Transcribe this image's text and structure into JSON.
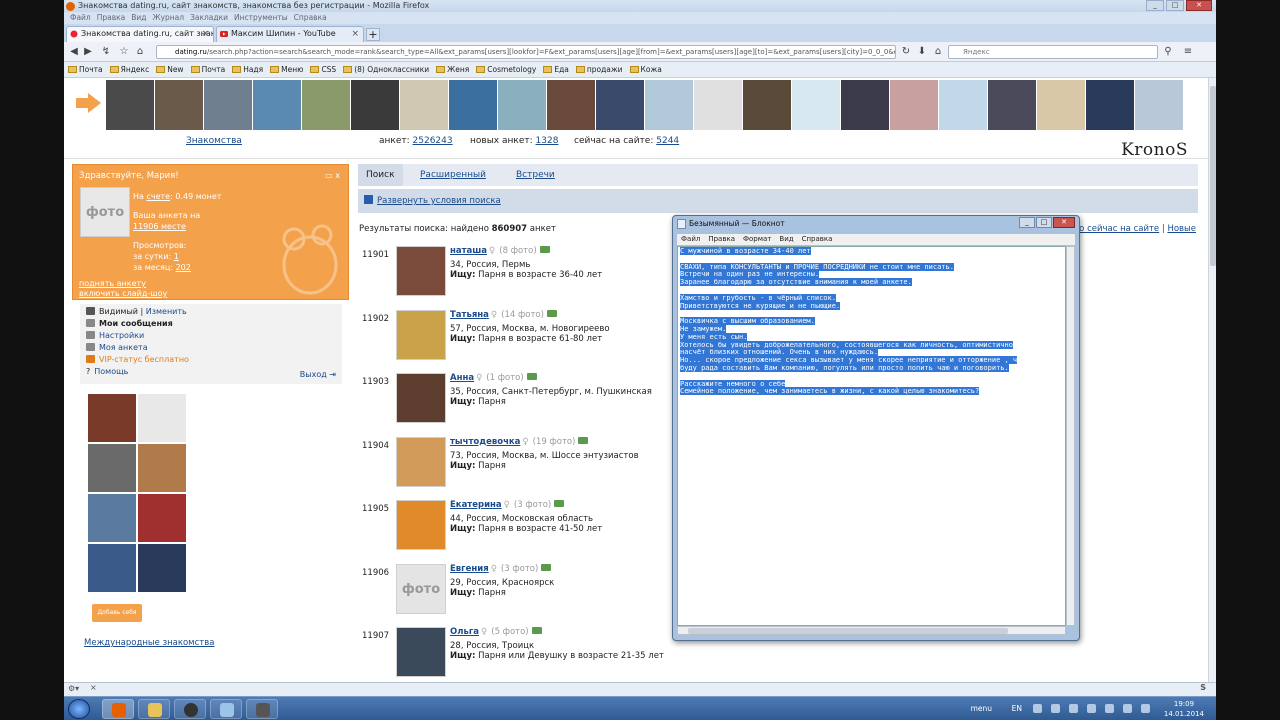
{
  "window": {
    "title": "Знакомства dating.ru, сайт знакомств, знакомства без регистрации - Mozilla Firefox",
    "menu": [
      "Файл",
      "Правка",
      "Вид",
      "Журнал",
      "Закладки",
      "Инструменты",
      "Справка"
    ]
  },
  "tabs": [
    {
      "label": "Знакомства dating.ru, сайт знакомств...",
      "active": true
    },
    {
      "label": "Максим Шипин - YouTube",
      "active": false
    }
  ],
  "url": {
    "host": "dating.ru",
    "path": "/search.php?action=search&search_mode=rank&search_type=All&ext_params[users][lookfor]=F&ext_params[users][age][from]=&ext_params[users][age][to]=&ext_params[users][city]=0_0_0&offset=119",
    "search_placeholder": "Яндекс"
  },
  "bookmarks": [
    "Почта",
    "Яндекс",
    "New",
    "Почта",
    "Надя",
    "Меню",
    "CSS",
    "(8) Одноклассники",
    "Женя",
    "Cosmetology",
    "Еда",
    "продажи",
    "Кожа"
  ],
  "stats": {
    "nav_link": "Знакомства",
    "ankets_label": "анкет:",
    "ankets_value": "2526243",
    "new_label": "новых анкет:",
    "new_value": "1328",
    "online_label": "сейчас на сайте:",
    "online_value": "5244",
    "logo": "KronoS"
  },
  "welcome": {
    "greeting": "Здравствуйте, Мария!",
    "photo_placeholder": "фото",
    "balance_prefix": "На ",
    "balance_link": "счете",
    "balance_suffix": ": 0.49 монет",
    "rank_line1": "Ваша анкета на",
    "rank_link": "11906 месте",
    "views_label": "Просмотров:",
    "views_day_label": "за сутки:",
    "views_day_value": "1",
    "views_month_label": "за месяц:",
    "views_month_value": "202",
    "raise_link": "поднять анкету",
    "slideshow_link": "включить слайд-шоу"
  },
  "user_menu": {
    "visible": "Видимый",
    "change": "Изменить",
    "messages": "Мои сообщения",
    "settings": "Настройки",
    "my_profile": "Моя анкета",
    "vip": "VIP-статус бесплатно",
    "help": "Помощь",
    "exit": "Выход"
  },
  "add_self": "Добавь себя",
  "intl_link": "Международные знакомства",
  "search_tabs": [
    "Поиск",
    "Расширенный",
    "Встречи"
  ],
  "expand_link": "Развернуть условия поиска",
  "results": {
    "prefix": "Результаты поиска: найдено",
    "count": "860907",
    "suffix": "анкет",
    "online_link": "то сейчас на сайте",
    "new_link": "Новые"
  },
  "profiles": [
    {
      "num": "11901",
      "name": "наташа",
      "photos": "(8 фото)",
      "info": "34, Россия, Пермь",
      "seek_label": "Ищу:",
      "seek": "Парня в возрасте 36-40 лет",
      "has_photo": true,
      "tone": "#7a4a3a"
    },
    {
      "num": "11902",
      "name": "Татьяна",
      "photos": "(14 фото)",
      "info": "57, Россия, Москва, м. Новогиреево",
      "seek_label": "Ищу:",
      "seek": "Парня в возрасте 61-80 лет",
      "has_photo": true,
      "tone": "#c9a24a"
    },
    {
      "num": "11903",
      "name": "Анна",
      "photos": "(1 фото)",
      "info": "35, Россия, Санкт-Петербург, м. Пушкинская",
      "seek_label": "Ищу:",
      "seek": "Парня",
      "has_photo": true,
      "tone": "#5c3d2e"
    },
    {
      "num": "11904",
      "name": "тычтодевочка",
      "photos": "(19 фото)",
      "info": "73, Россия, Москва, м. Шоссе энтузиастов",
      "seek_label": "Ищу:",
      "seek": "Парня",
      "has_photo": true,
      "tone": "#d39b5a"
    },
    {
      "num": "11905",
      "name": "Екатерина",
      "photos": "(3 фото)",
      "info": "44, Россия, Московская область",
      "seek_label": "Ищу:",
      "seek": "Парня в возрасте 41-50 лет",
      "has_photo": true,
      "tone": "#e08a2a"
    },
    {
      "num": "11906",
      "name": "Евгения",
      "photos": "(3 фото)",
      "info": "29, Россия, Красноярск",
      "seek_label": "Ищу:",
      "seek": "Парня",
      "has_photo": false,
      "tone": "#e4e4e4"
    },
    {
      "num": "11907",
      "name": "Ольга",
      "photos": "(5 фото)",
      "info": "28, Россия, Троицк",
      "seek_label": "Ищу:",
      "seek": "Парня или Девушку в возрасте 21-35 лет",
      "has_photo": true,
      "tone": "#3a4a5a"
    }
  ],
  "notepad": {
    "title": "Безымянный — Блокнот",
    "menu": [
      "Файл",
      "Правка",
      "Формат",
      "Вид",
      "Справка"
    ],
    "lines": [
      "С мужчиной в возрасте 34-40 лет",
      "",
      "СВАХИ, типа КОНСУЛЬТАНТЫ и ПРОЧИЕ ПОСРЕДНИКИ не стоит мне писать.",
      "Встречи на один раз не интересны.",
      "Заранее благодарю за отсутствие внимания к моей анкете.",
      "",
      "Хамство и грубость - в чёрный список.",
      "Приветствуются не курящие и не пьющие.",
      "",
      "Москвичка с высшим образованием.",
      "Не замужем.",
      "У меня есть сын.",
      "Хотелось бы увидеть доброжелательного, состоявшегося как личность, оптимистично",
      "насчёт близких отношений. Очень в них нуждаюсь.",
      "Но... скорое предложение секса вызывает у меня скорее неприятие и отторжение , ч",
      "буду рада составить Вам компанию, погулять или просто попить чаю и поговорить.",
      "",
      "Расскажите немного о себе",
      "Семейное положение, чем занимаетесь в жизни, с какой целью знакомитесь?"
    ]
  },
  "taskbar": {
    "menu_label": "menu",
    "lang": "EN",
    "time": "19:09",
    "date": "14.01.2014"
  },
  "colors": {
    "orange": "#f4a14c",
    "link": "#1a4b8c",
    "selection": "#3377d6"
  }
}
